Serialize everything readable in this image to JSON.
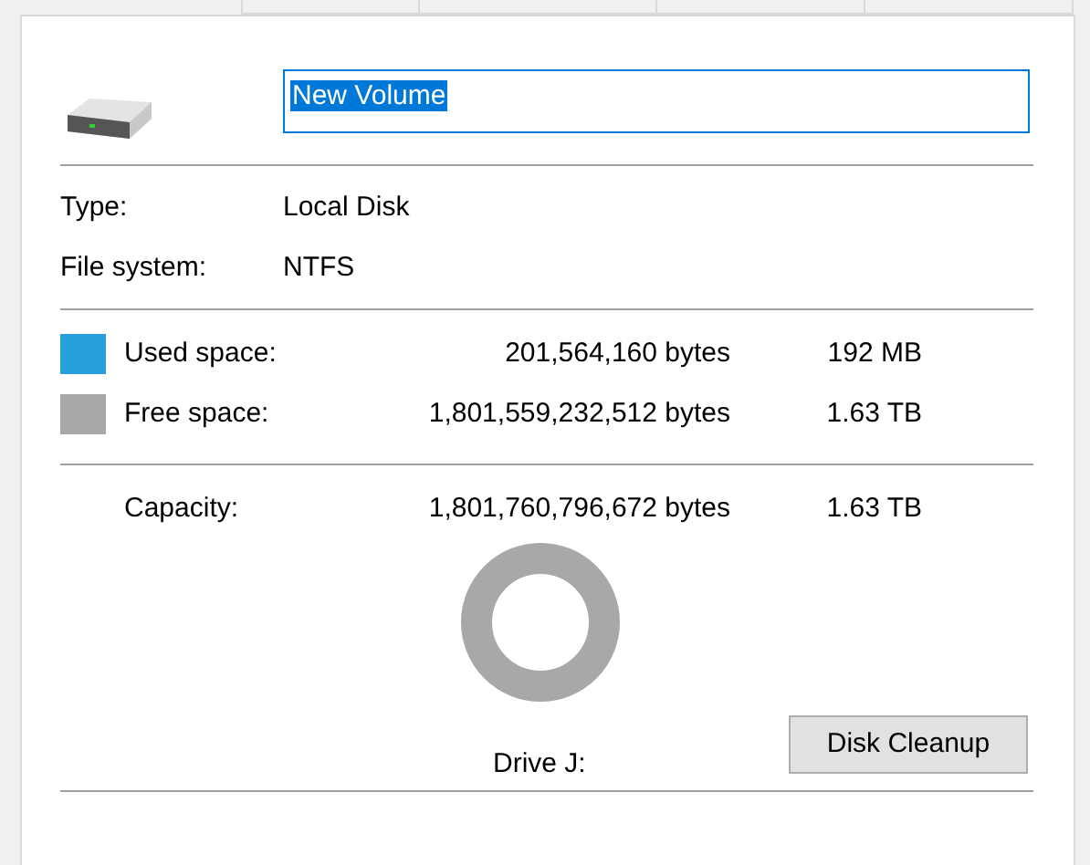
{
  "volume_name": {
    "value": "New Volume",
    "selected": true
  },
  "info": [
    {
      "label": "Type:",
      "value": "Local Disk"
    },
    {
      "label": "File system:",
      "value": "NTFS"
    }
  ],
  "space": [
    {
      "label": "Used space:",
      "bytes": "201,564,160 bytes",
      "size": "192 MB",
      "color": "#26a0da"
    },
    {
      "label": "Free space:",
      "bytes": "1,801,559,232,512 bytes",
      "size": "1.63 TB",
      "color": "#a8a8a8"
    }
  ],
  "capacity": {
    "label": "Capacity:",
    "bytes": "1,801,760,796,672 bytes",
    "size": "1.63 TB"
  },
  "drive_label": "Drive J:",
  "buttons": [
    "Disk Cleanup"
  ]
}
